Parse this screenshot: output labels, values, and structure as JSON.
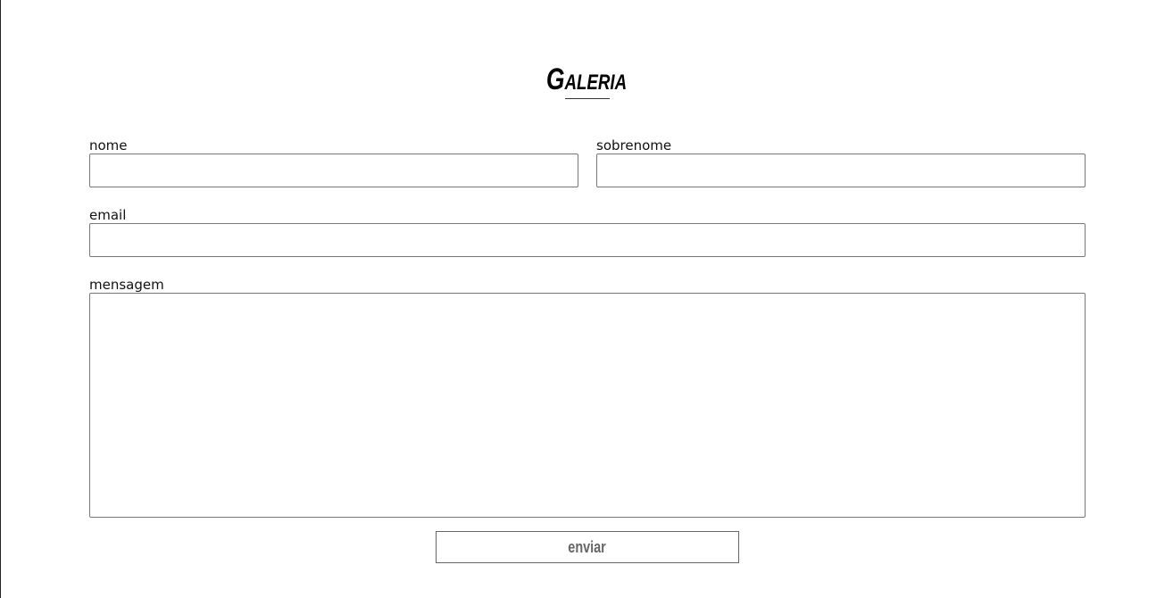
{
  "page": {
    "title": "Galeria"
  },
  "form": {
    "fields": {
      "first_name": {
        "label": "nome",
        "value": "",
        "placeholder": ""
      },
      "last_name": {
        "label": "sobrenome",
        "value": "",
        "placeholder": ""
      },
      "email": {
        "label": "email",
        "value": "",
        "placeholder": ""
      },
      "message": {
        "label": "mensagem",
        "value": "",
        "placeholder": ""
      }
    },
    "submit_label": "enviar"
  },
  "colors": {
    "background": "#ffffff",
    "text": "#111111",
    "border": "#777777",
    "button_text": "#666666"
  }
}
